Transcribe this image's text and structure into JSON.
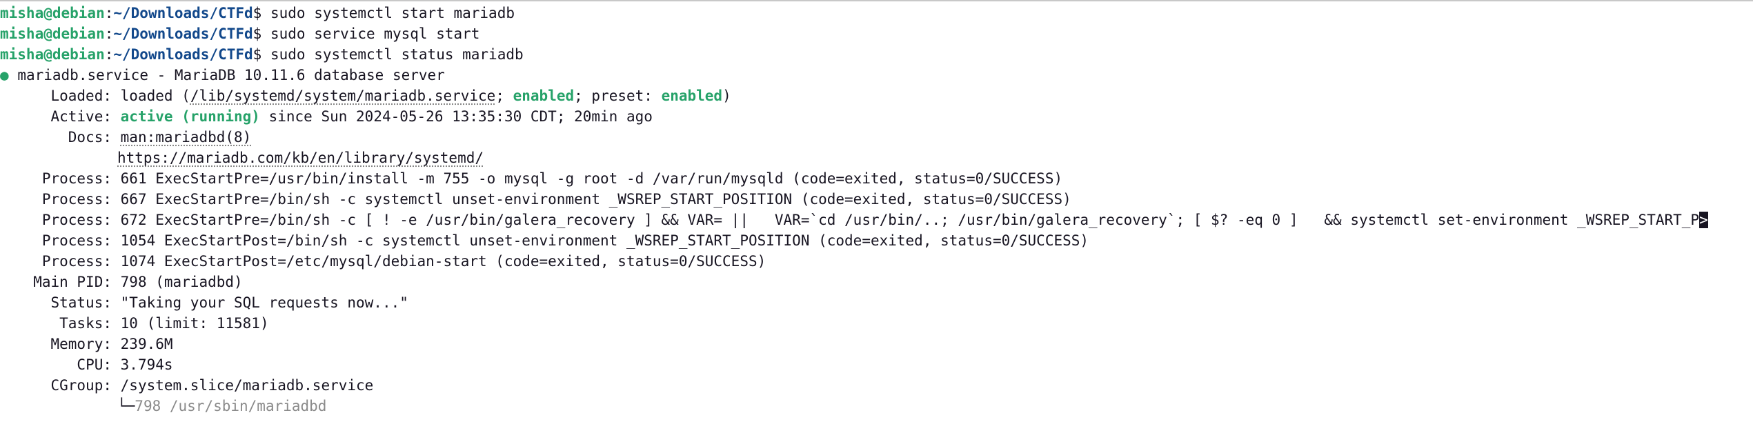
{
  "prompt": {
    "user": "misha@debian",
    "sep": ":",
    "path": "~/Downloads/CTFd",
    "dollar": "$"
  },
  "commands": [
    "sudo systemctl start mariadb",
    "sudo service mysql start",
    "sudo systemctl status mariadb"
  ],
  "status": {
    "bullet": "●",
    "unit_line": "mariadb.service - MariaDB 10.11.6 database server",
    "loaded": {
      "label": "Loaded:",
      "pre": "loaded (",
      "file": "/lib/systemd/system/mariadb.service",
      "mid": "; ",
      "enabled": "enabled",
      "mid2": "; preset: ",
      "preset": "enabled",
      "post": ")"
    },
    "active": {
      "label": "Active:",
      "state": "active (running)",
      "rest": " since Sun 2024-05-26 13:35:30 CDT; 20min ago"
    },
    "docs": {
      "label": "Docs:",
      "items": [
        "man:mariadbd(8)",
        "https://mariadb.com/kb/en/library/systemd/"
      ]
    },
    "processes": {
      "label": "Process:",
      "items": [
        "661 ExecStartPre=/usr/bin/install -m 755 -o mysql -g root -d /var/run/mysqld (code=exited, status=0/SUCCESS)",
        "667 ExecStartPre=/bin/sh -c systemctl unset-environment _WSREP_START_POSITION (code=exited, status=0/SUCCESS)",
        "672 ExecStartPre=/bin/sh -c [ ! -e /usr/bin/galera_recovery ] && VAR= ||   VAR=`cd /usr/bin/..; /usr/bin/galera_recovery`; [ $? -eq 0 ]   && systemctl set-environment _WSREP_START_P",
        "1054 ExecStartPost=/bin/sh -c systemctl unset-environment _WSREP_START_POSITION (code=exited, status=0/SUCCESS)",
        "1074 ExecStartPost=/etc/mysql/debian-start (code=exited, status=0/SUCCESS)"
      ],
      "overflow_marker": ">"
    },
    "main_pid": {
      "label": "Main PID:",
      "value": "798 (mariadbd)"
    },
    "status_text": {
      "label": "Status:",
      "value": "\"Taking your SQL requests now...\""
    },
    "tasks": {
      "label": "Tasks:",
      "value": "10 (limit: 11581)"
    },
    "memory": {
      "label": "Memory:",
      "value": "239.6M"
    },
    "cpu": {
      "label": "CPU:",
      "value": "3.794s"
    },
    "cgroup": {
      "label": "CGroup:",
      "value": "/system.slice/mariadb.service",
      "child_branch": "└─",
      "child": "798 /usr/sbin/mariadbd"
    }
  }
}
